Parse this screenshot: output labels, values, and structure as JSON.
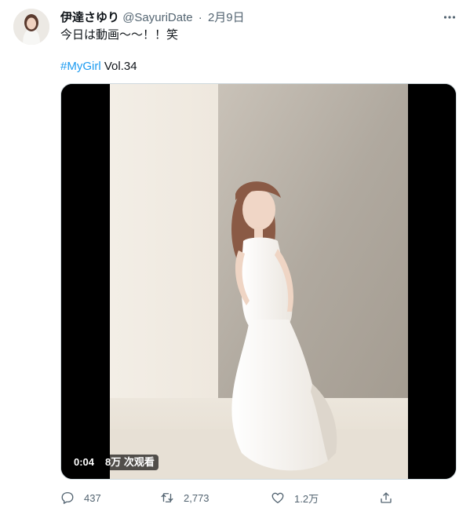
{
  "tweet": {
    "display_name": "伊達さゆり",
    "handle": "@SayuriDate",
    "separator": "·",
    "date": "2月9日",
    "text": "今日は動画〜〜！！笑",
    "hashtag": "#MyGirl",
    "hashtag_suffix": " Vol.34"
  },
  "video": {
    "timestamp": "0:04",
    "views": "8万 次观看"
  },
  "actions": {
    "reply_count": "437",
    "retweet_count": "2,773",
    "like_count": "1.2万"
  },
  "colors": {
    "link": "#1d9bf0",
    "secondary_text": "#536471"
  }
}
